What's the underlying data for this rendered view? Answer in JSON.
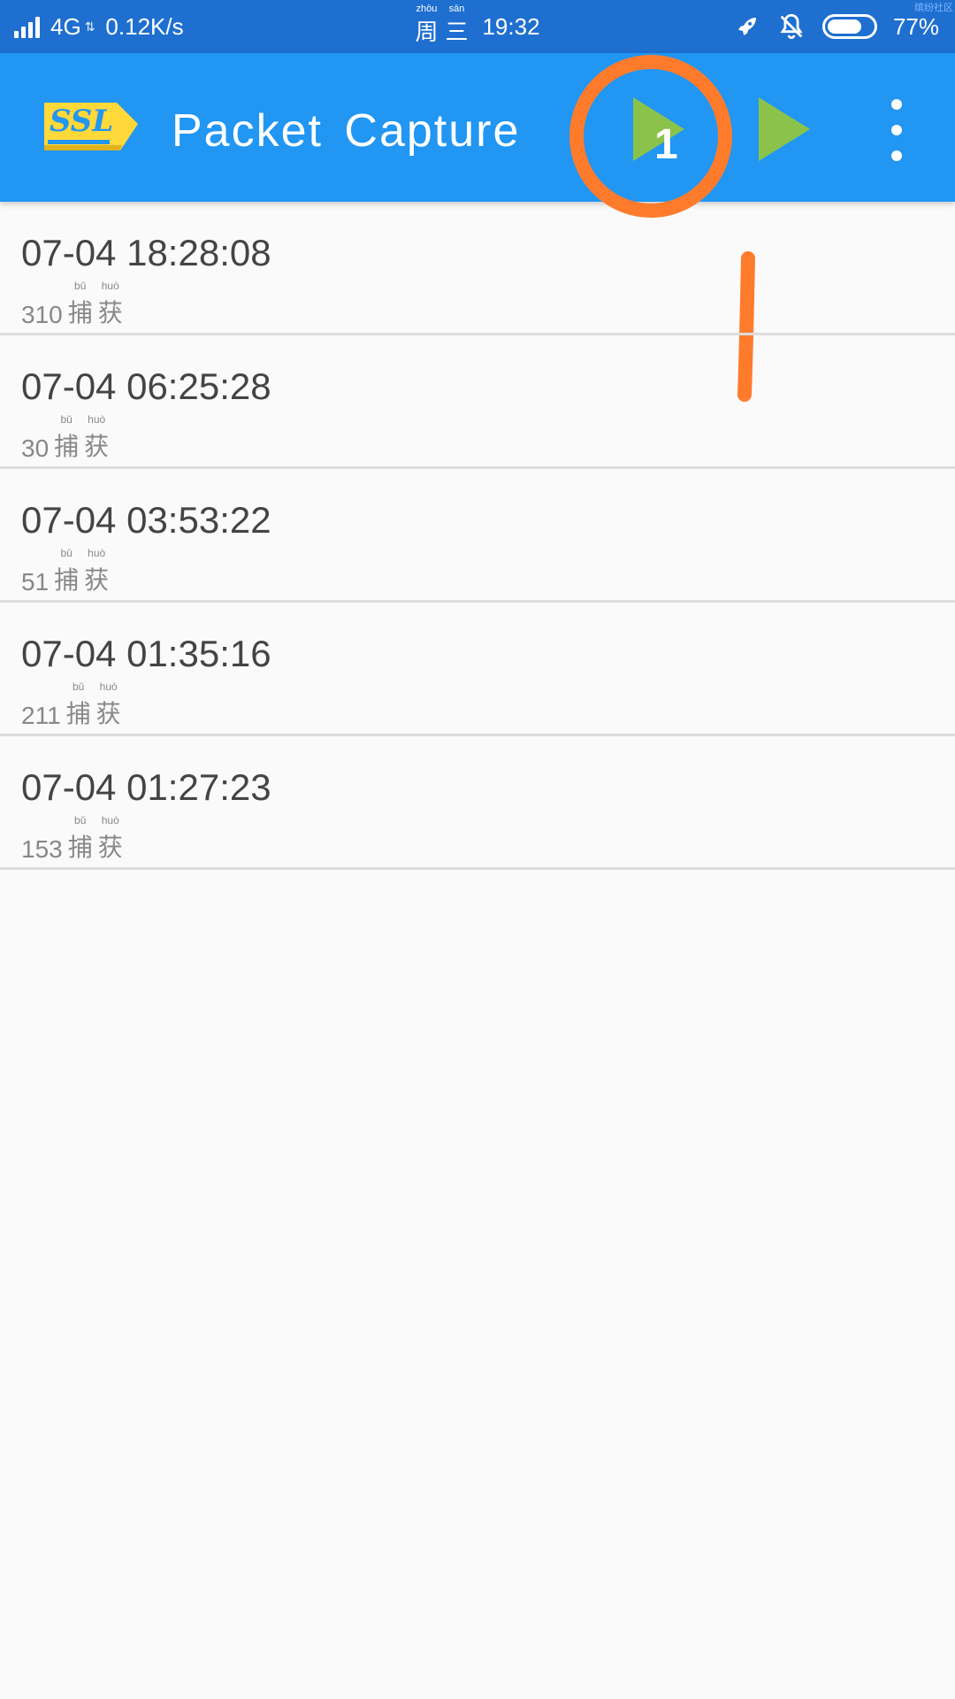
{
  "status_bar": {
    "network_type": "4G",
    "network_speed": "0.12K/s",
    "weekday_chars": [
      "周",
      "三"
    ],
    "weekday_pinyin": [
      "zhōu",
      "sān"
    ],
    "time": "19:32",
    "battery_percent": "77%",
    "battery_level": 0.77,
    "watermark": "缤纷社区"
  },
  "app_bar": {
    "logo_text": "SSL",
    "title": "Packet  Capture",
    "icons": [
      "ssl-start-icon",
      "play-icon",
      "more-vert-icon"
    ],
    "play_color": "#8bc34a"
  },
  "annotation": {
    "number": "1",
    "color": "#ff7b2c"
  },
  "captures": [
    {
      "time": "07-04  18:28:08",
      "count": "310"
    },
    {
      "time": "07-04  06:25:28",
      "count": "30"
    },
    {
      "time": "07-04  03:53:22",
      "count": "51"
    },
    {
      "time": "07-04  01:35:16",
      "count": "211"
    },
    {
      "time": "07-04  01:27:23",
      "count": "153"
    }
  ],
  "capture_label": {
    "chars": [
      "捕",
      "获"
    ],
    "pinyin": [
      "bǔ",
      "huò"
    ]
  }
}
